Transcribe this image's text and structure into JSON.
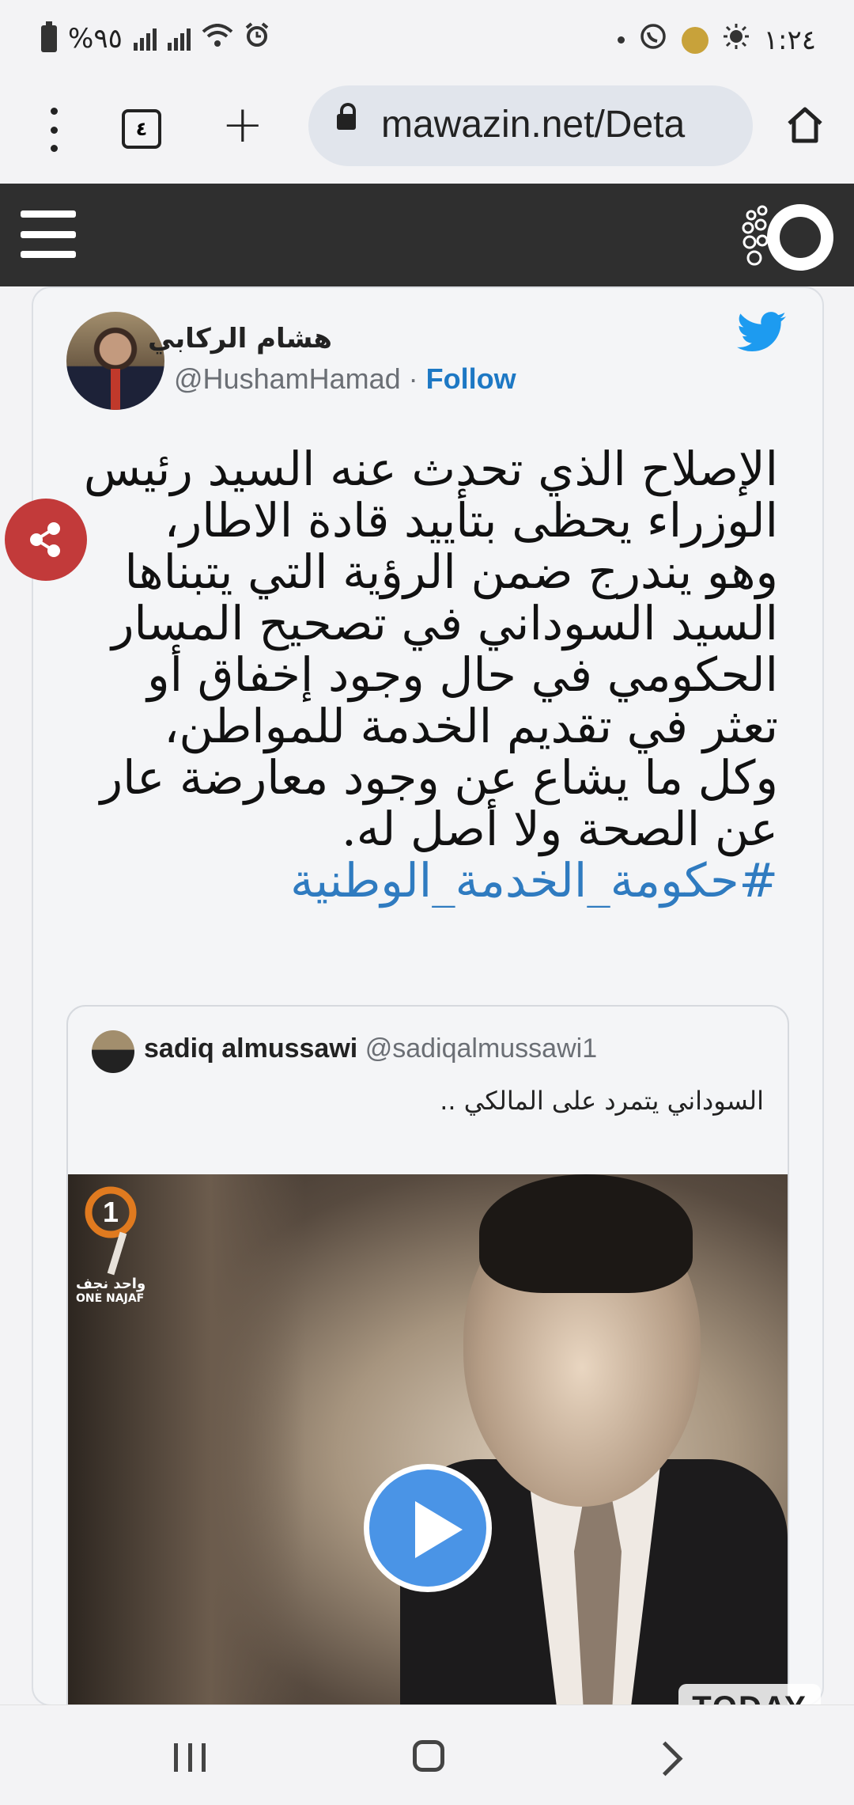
{
  "status_bar": {
    "battery_text": "%٩٥",
    "time": "١:٢٤"
  },
  "browser": {
    "tab_count": "٤",
    "url": "mawazin.net/Deta"
  },
  "tweet": {
    "author_name": "هشام الركابي",
    "author_handle": "@HushamHamad",
    "separator": " · ",
    "follow_label": "Follow",
    "text": "الإصلاح الذي تحدث عنه السيد رئيس الوزراء يحظى بتأييد قادة الاطار، وهو يندرج ضمن الرؤية التي يتبناها السيد السوداني في تصحيح المسار الحكومي في حال وجود إخفاق أو تعثر في تقديم الخدمة للمواطن، وكل ما يشاع عن وجود معارضة عار عن الصحة ولا أصل له.",
    "hashtag": "#حكومة_الخدمة_الوطنية"
  },
  "quoted_tweet": {
    "author_name": "sadiq almussawi",
    "author_handle": "@sadiqalmussawi1",
    "text": "السوداني يتمرد على المالكي ..",
    "channel_logo_text": "واحد نجف",
    "channel_logo_sub": "ONE NAJAF"
  },
  "watermark": "TODAY",
  "colors": {
    "site_header": "#2f2f2f",
    "twitter_blue": "#1d9bf0",
    "link_blue": "#2f7bc0",
    "share_fab": "#c23a3a",
    "play_button": "#4a94e6"
  },
  "icons": {
    "menu": "three-dots-vertical",
    "tabs": "tab-switcher",
    "new_tab": "plus",
    "lock": "padlock",
    "home": "house",
    "site_menu": "hamburger",
    "share": "share-nodes",
    "twitter": "bird",
    "play": "play-triangle"
  }
}
